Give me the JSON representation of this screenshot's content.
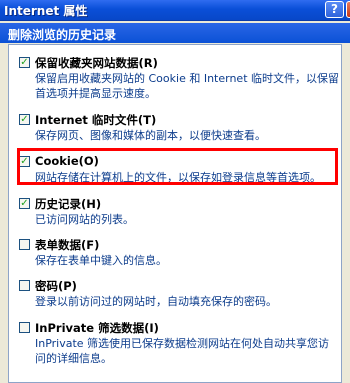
{
  "window": {
    "title": "Internet 属性",
    "help_glyph": "?",
    "close_glyph": "X"
  },
  "dialog": {
    "header": "删除浏览的历史记录"
  },
  "items": [
    {
      "checked": true,
      "check_glyph": "✓",
      "title": "保留收藏夹网站数据(R)",
      "desc": "保留启用收藏夹网站的 Cookie 和 Internet 临时文件，以保留首选项并提高显示速度。"
    },
    {
      "checked": true,
      "check_glyph": "✓",
      "title": "Internet 临时文件(T)",
      "desc": "保存网页、图像和媒体的副本，以便快速查看。"
    },
    {
      "checked": true,
      "check_glyph": "✓",
      "title": "Cookie(O)",
      "desc": "网站存储在计算机上的文件，以保存如登录信息等首选项。"
    },
    {
      "checked": true,
      "check_glyph": "✓",
      "title": "历史记录(H)",
      "desc": "已访问网站的列表。"
    },
    {
      "checked": false,
      "check_glyph": "",
      "title": "表单数据(F)",
      "desc": "保存在表单中键入的信息。"
    },
    {
      "checked": false,
      "check_glyph": "",
      "title": "密码(P)",
      "desc": "登录以前访问过的网站时，自动填充保存的密码。"
    },
    {
      "checked": false,
      "check_glyph": "",
      "title": "InPrivate 筛选数据(I)",
      "desc": "InPrivate 筛选使用已保存数据检测网站在何处自动共享您访问的详细信息。"
    }
  ],
  "colors": {
    "titlebar": "#0a4fd8",
    "highlight": "#ff0000",
    "desc_text": "#0c3c8c",
    "check": "#21a121"
  }
}
